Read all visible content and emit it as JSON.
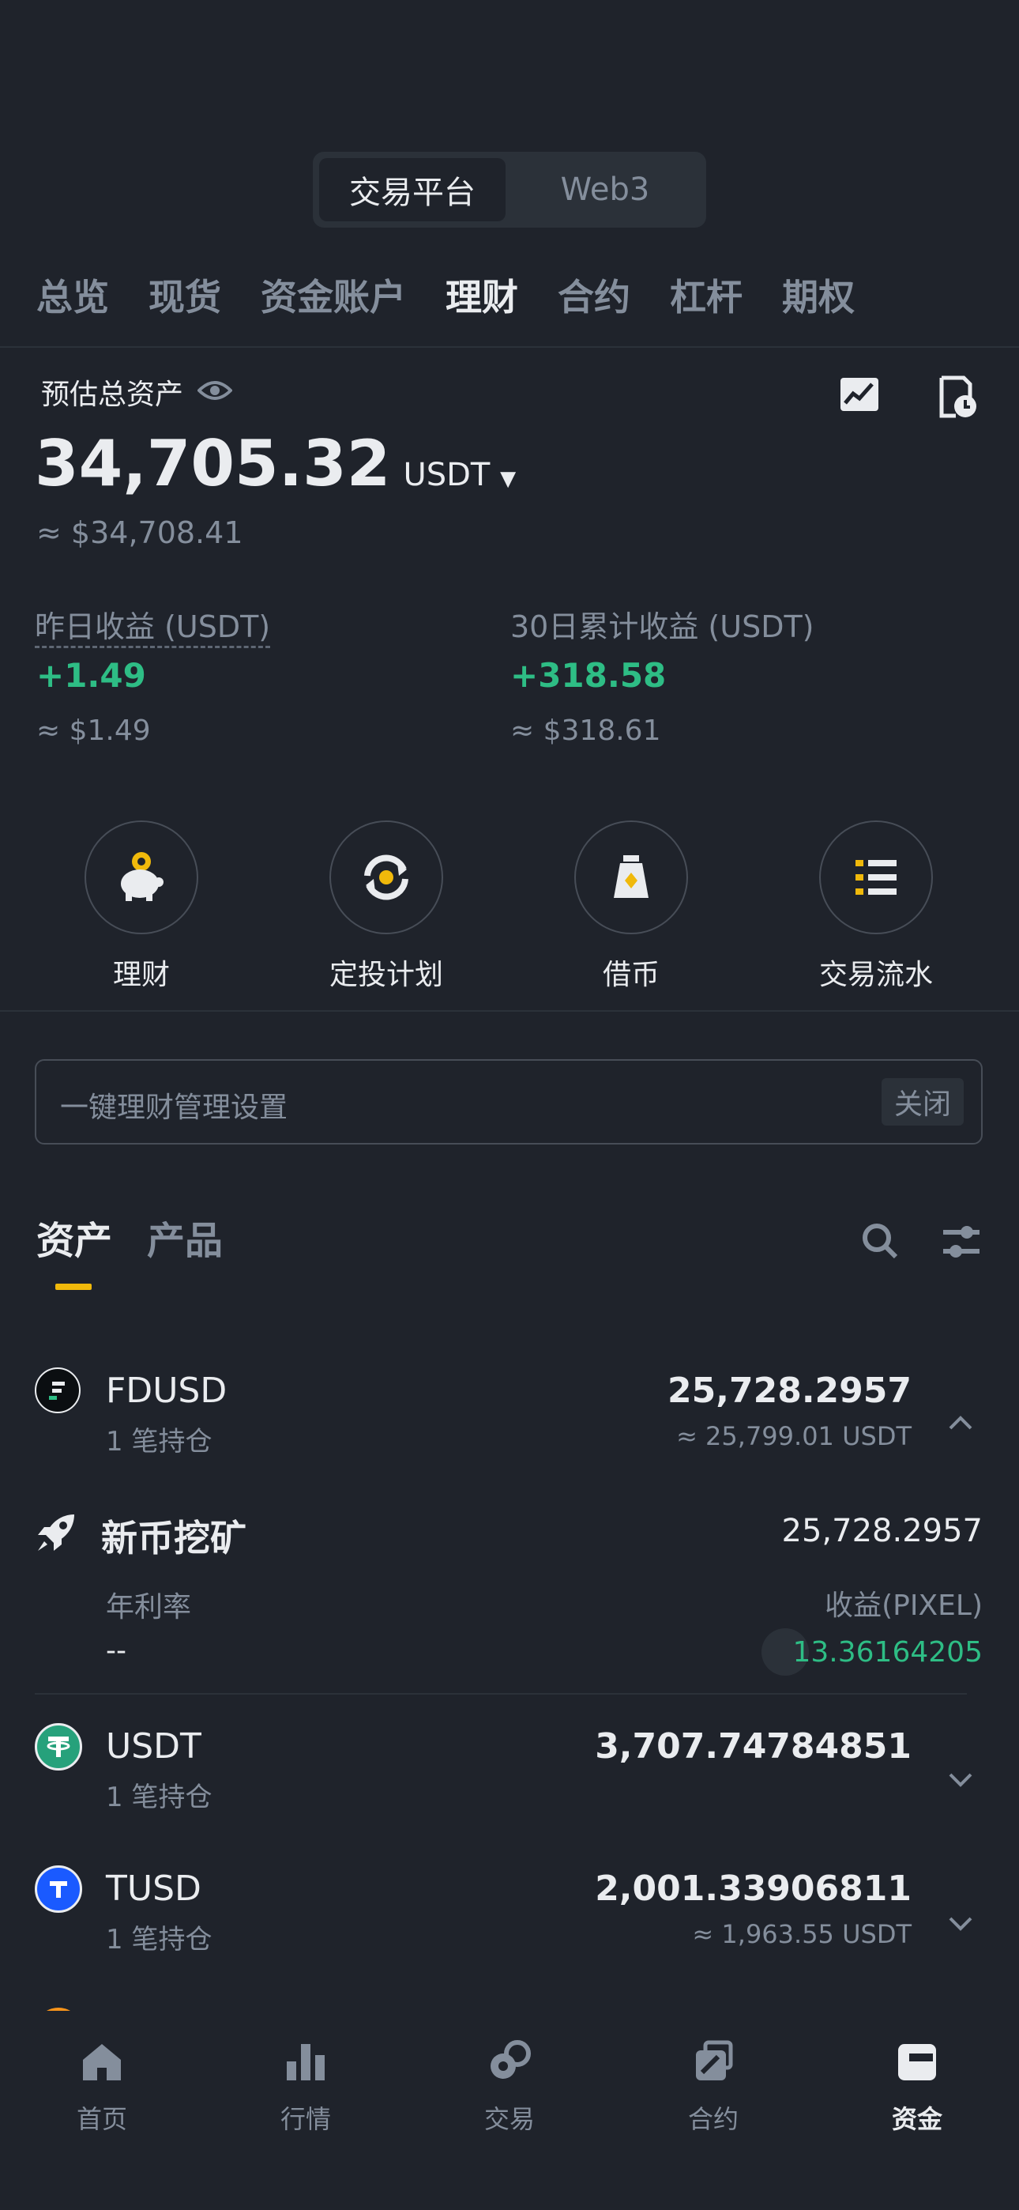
{
  "top_switch": {
    "active": "交易平台",
    "inactive": "Web3"
  },
  "tabs": [
    {
      "label": "总览",
      "active": false
    },
    {
      "label": "现货",
      "active": false
    },
    {
      "label": "资金账户",
      "active": false
    },
    {
      "label": "理财",
      "active": true
    },
    {
      "label": "合约",
      "active": false
    },
    {
      "label": "杠杆",
      "active": false
    },
    {
      "label": "期权",
      "active": false
    }
  ],
  "summary": {
    "label": "预估总资产",
    "total": "34,705.32",
    "unit": "USDT",
    "approx": "≈ $34,708.41",
    "yesterday_label": "昨日收益 (USDT)",
    "yesterday_value": "+1.49",
    "yesterday_approx": "≈ $1.49",
    "month_label": "30日累计收益 (USDT)",
    "month_value": "+318.58",
    "month_approx": "≈ $318.61"
  },
  "actions": [
    {
      "label": "理财",
      "icon": "piggy-bank-icon"
    },
    {
      "label": "定投计划",
      "icon": "recurring-icon"
    },
    {
      "label": "借币",
      "icon": "loan-bag-icon"
    },
    {
      "label": "交易流水",
      "icon": "list-icon"
    }
  ],
  "setting_bar": {
    "label": "一键理财管理设置",
    "button": "关闭"
  },
  "section_tabs": {
    "assets": "资产",
    "products": "产品"
  },
  "assets": [
    {
      "name": "FDUSD",
      "holdings": "1 笔持仓",
      "amount": "25,728.2957",
      "approx": "≈ 25,799.01 USDT",
      "expanded": true
    },
    {
      "name": "USDT",
      "holdings": "1 笔持仓",
      "amount": "3,707.74784851",
      "approx": "",
      "expanded": false
    },
    {
      "name": "TUSD",
      "holdings": "1 笔持仓",
      "amount": "2,001.33906811",
      "approx": "≈ 1,963.55 USDT",
      "expanded": false
    }
  ],
  "expanded_detail": {
    "title": "新币挖矿",
    "amount": "25,728.2957",
    "apr_label": "年利率",
    "apr_value": "--",
    "reward_label": "收益(PIXEL)",
    "reward_value": "13.36164205"
  },
  "bottom_nav": [
    {
      "label": "首页",
      "icon": "home-icon",
      "active": false
    },
    {
      "label": "行情",
      "icon": "market-bars-icon",
      "active": false
    },
    {
      "label": "交易",
      "icon": "trade-icon",
      "active": false
    },
    {
      "label": "合约",
      "icon": "futures-icon",
      "active": false
    },
    {
      "label": "资金",
      "icon": "wallet-icon",
      "active": true
    }
  ],
  "colors": {
    "accent": "#f0b90b",
    "up": "#2ebd85",
    "bg": "#1f232b"
  }
}
